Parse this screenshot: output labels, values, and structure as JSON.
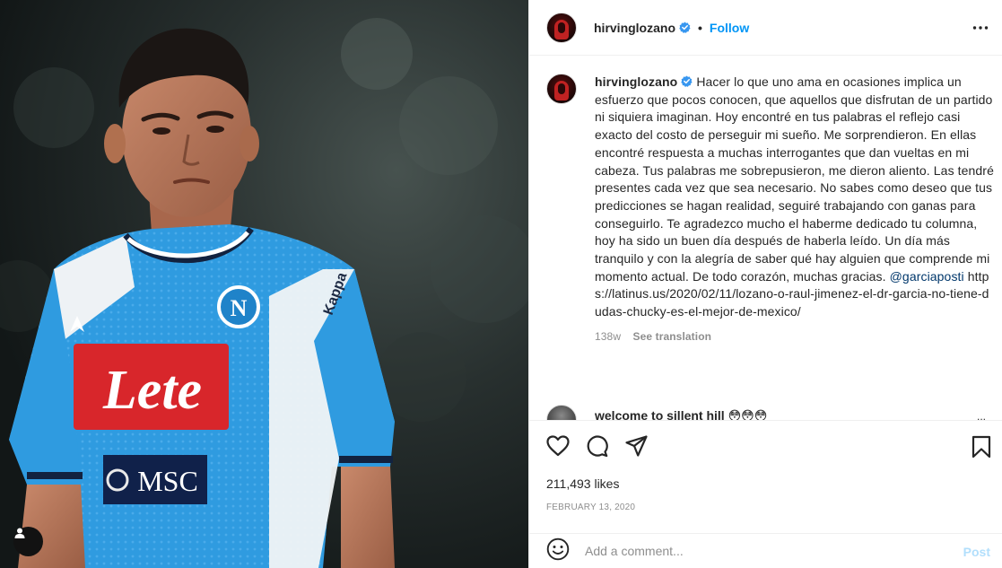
{
  "post": {
    "username": "hirvinglozano",
    "follow_label": "Follow",
    "separator": "•",
    "photo": {
      "sponsor": "Lete",
      "chest_logo": "MSC",
      "crest_letter": "N",
      "brand": "Kappa"
    }
  },
  "caption": {
    "username": "hirvinglozano",
    "text": "Hacer lo que uno ama en ocasiones implica un esfuerzo que pocos conocen, que aquellos que disfrutan de un partido ni siquiera imaginan. Hoy encontré en tus palabras el reflejo casi exacto del costo de perseguir mi sueño. Me sorprendieron. En ellas encontré respuesta a muchas interrogantes que dan vueltas en mi cabeza. Tus palabras me sobrepusieron, me dieron aliento. Las tendré presentes cada vez que sea necesario. No sabes como deseo que tus predicciones se hagan realidad, seguiré trabajando con ganas para conseguirlo. Te agradezco mucho el haberme dedicado tu columna, hoy ha sido un buen día después de haberla leído. Un día más tranquilo y con la alegría de saber qué hay alguien que comprende mi momento actual. De todo corazón, muchas gracias. ",
    "mention": "@garciaposti",
    "link": " https://latinus.us/2020/02/11/lozano-o-raul-jimenez-el-dr-garcia-no-tiene-dudas-chucky-es-el-mejor-de-mexico/",
    "age": "138w",
    "see_translation": "See translation"
  },
  "comment_preview": {
    "text": "welcome to sillent hill 😳😳😳",
    "more": "..."
  },
  "stats": {
    "likes": "211,493 likes",
    "date": "FEBRUARY 13, 2020"
  },
  "add_comment": {
    "placeholder": "Add a comment...",
    "post_label": "Post"
  },
  "icons": {
    "verified": "verified-badge-icon",
    "more": "more-options-icon",
    "like": "heart-icon",
    "comment": "comment-bubble-icon",
    "share": "paper-plane-icon",
    "save": "bookmark-icon",
    "emoji": "emoji-icon",
    "tag": "user-tag-icon"
  },
  "colors": {
    "accent": "#0095f6",
    "post_disabled": "#b2dffc",
    "jersey": "#2f9be0",
    "sponsor_red": "#d8262b"
  }
}
